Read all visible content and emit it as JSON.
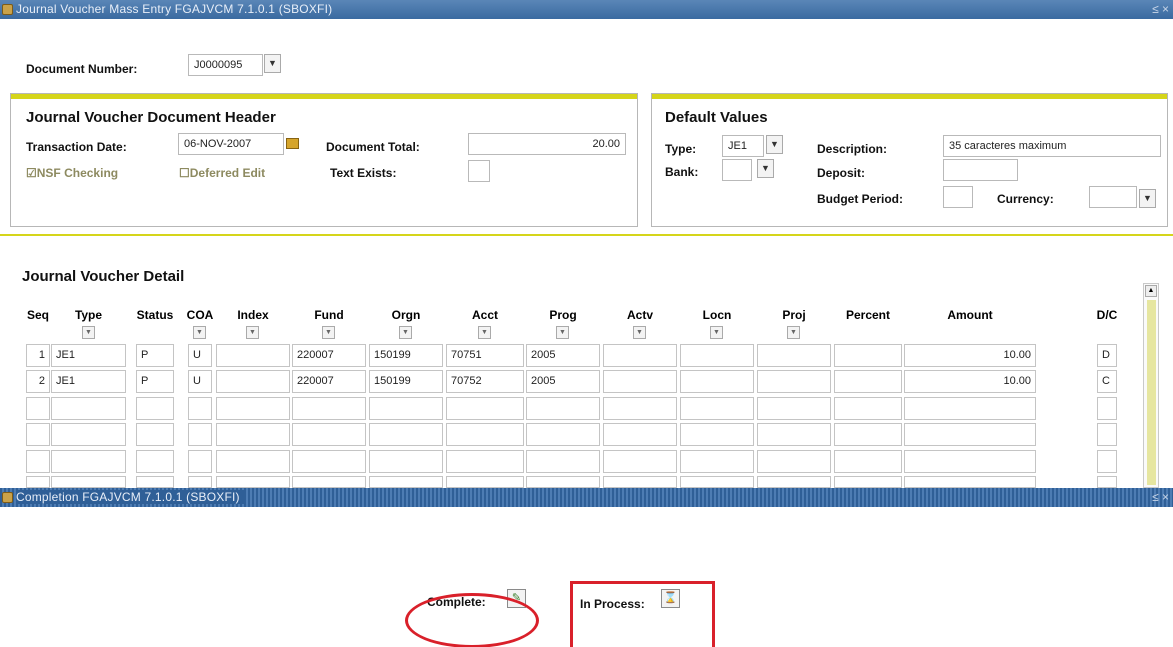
{
  "window": {
    "title": "Journal Voucher Mass Entry  FGAJVCM  7.1.0.1  (SBOXFI)",
    "controls": "≤ ×"
  },
  "key_block": {
    "document_number_label": "Document Number:",
    "document_number_value": "J0000095"
  },
  "header": {
    "title": "Journal Voucher Document Header",
    "transaction_date_label": "Transaction Date:",
    "transaction_date_value": "06-NOV-2007",
    "document_total_label": "Document Total:",
    "document_total_value": "20.00",
    "nsf_checking_label": "☑NSF Checking",
    "deferred_edit_label": "☐Deferred Edit",
    "text_exists_label": "Text Exists:"
  },
  "defaults": {
    "title": "Default Values",
    "type_label": "Type:",
    "type_value": "JE1",
    "description_label": "Description:",
    "description_value": "35 caracteres maximum",
    "bank_label": "Bank:",
    "deposit_label": "Deposit:",
    "budget_period_label": "Budget Period:",
    "currency_label": "Currency:"
  },
  "detail": {
    "title": "Journal Voucher Detail",
    "columns": [
      "Seq",
      "Type",
      "Status",
      "COA",
      "Index",
      "Fund",
      "Orgn",
      "Acct",
      "Prog",
      "Actv",
      "Locn",
      "Proj",
      "Percent",
      "Amount",
      "D/C"
    ],
    "rows": [
      [
        "1",
        "JE1",
        "P",
        "U",
        "",
        "220007",
        "150199",
        "70751",
        "2005",
        "",
        "",
        "",
        "",
        "10.00",
        "D"
      ],
      [
        "2",
        "JE1",
        "P",
        "U",
        "",
        "220007",
        "150199",
        "70752",
        "2005",
        "",
        "",
        "",
        "",
        "10.00",
        "C"
      ],
      [
        "",
        "",
        "",
        "",
        "",
        "",
        "",
        "",
        "",
        "",
        "",
        "",
        "",
        "",
        ""
      ],
      [
        "",
        "",
        "",
        "",
        "",
        "",
        "",
        "",
        "",
        "",
        "",
        "",
        "",
        "",
        ""
      ],
      [
        "",
        "",
        "",
        "",
        "",
        "",
        "",
        "",
        "",
        "",
        "",
        "",
        "",
        "",
        ""
      ],
      [
        "",
        "",
        "",
        "",
        "",
        "",
        "",
        "",
        "",
        "",
        "",
        "",
        "",
        "",
        ""
      ]
    ]
  },
  "completion_window": {
    "title": "Completion  FGAJVCM  7.1.0.1  (SBOXFI)",
    "controls": "≤ ×",
    "complete_label": "Complete:",
    "in_process_label": "In Process:"
  },
  "icons": {
    "calendar": "calendar-icon",
    "complete": "complete-icon",
    "in_process": "hourglass-icon"
  },
  "colors": {
    "titlebar": "#3a6aa0",
    "accent_bar": "#d5d51a",
    "highlight": "#d9202a"
  }
}
